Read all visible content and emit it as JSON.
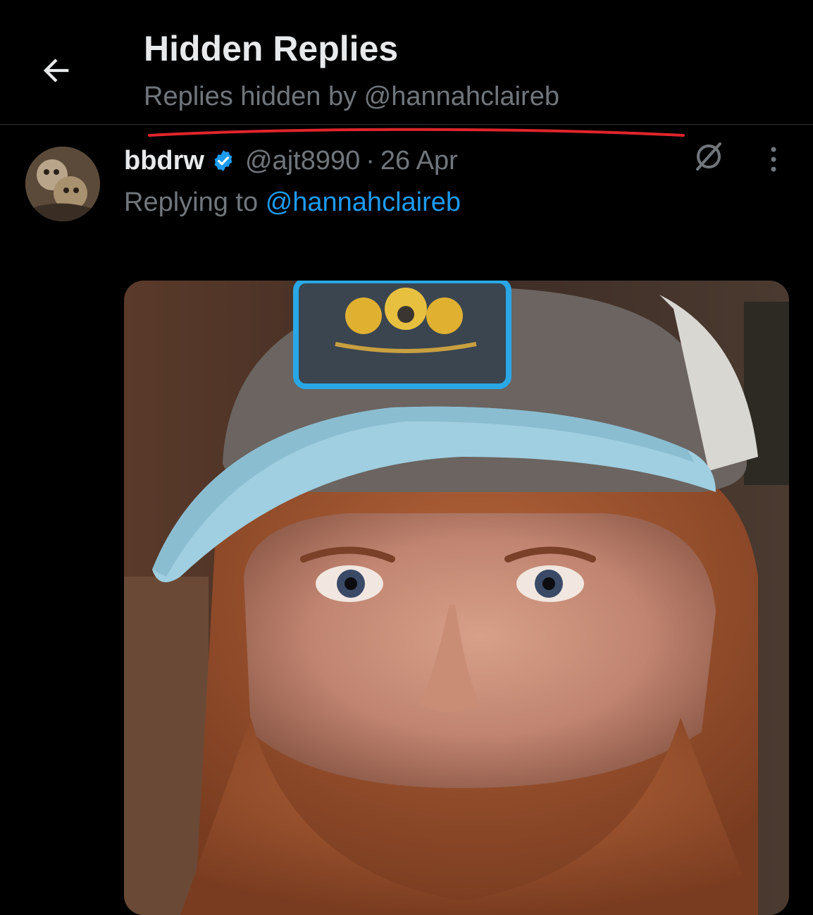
{
  "header": {
    "title": "Hidden Replies",
    "subtitle": "Replies hidden by @hannahclaireb"
  },
  "tweet": {
    "display_name": "bbdrw",
    "handle": "@ajt8990",
    "separator": "·",
    "date": "26 Apr",
    "replying_prefix": "Replying to",
    "replying_to": "@hannahclaireb"
  },
  "icons": {
    "back": "arrow-left-icon",
    "verified": "verified-badge-icon",
    "grok": "grok-icon",
    "more": "more-vertical-icon"
  },
  "colors": {
    "background": "#000000",
    "text_primary": "#e7e9ea",
    "text_secondary": "#71767b",
    "link": "#1d9bf0",
    "verified": "#1d9bf0",
    "annotation": "#e0252b"
  }
}
